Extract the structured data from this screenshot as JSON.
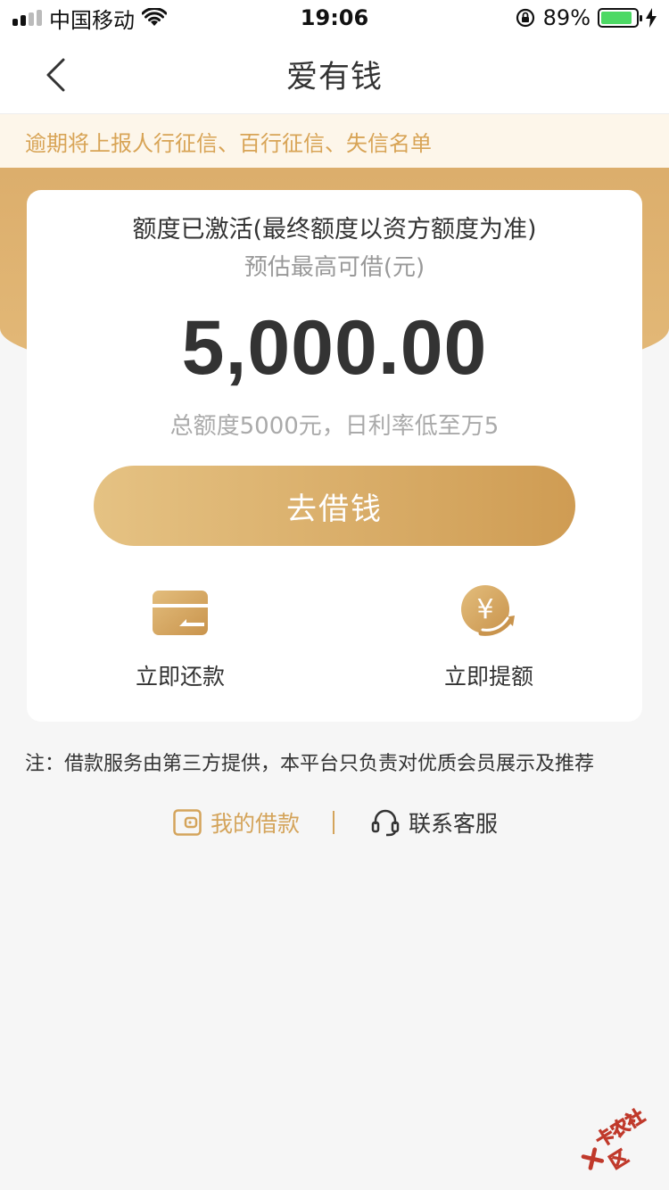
{
  "status_bar": {
    "carrier": "中国移动",
    "time": "19:06",
    "battery": "89%"
  },
  "nav": {
    "title": "爱有钱"
  },
  "notice": {
    "text": "逾期将上报人行征信、百行征信、失信名单"
  },
  "card": {
    "title": "额度已激活(最终额度以资方额度为准)",
    "subtitle": "预估最高可借(元)",
    "amount": "5,000.00",
    "amount_desc": "总额度5000元，日利率低至万5",
    "borrow_button": "去借钱",
    "actions": [
      {
        "label": "立即还款",
        "icon": "card-icon"
      },
      {
        "label": "立即提额",
        "icon": "yuan-up-icon"
      }
    ]
  },
  "note": "注：借款服务由第三方提供，本平台只负责对优质会员展示及推荐",
  "links": {
    "my_loans": "我的借款",
    "customer_service": "联系客服"
  },
  "watermark": "卡农社区",
  "colors": {
    "gold": "#dcae6c",
    "gold_text": "#d4a45b",
    "notice_bg": "#fdf6ea",
    "page_bg": "#f6f6f6"
  }
}
